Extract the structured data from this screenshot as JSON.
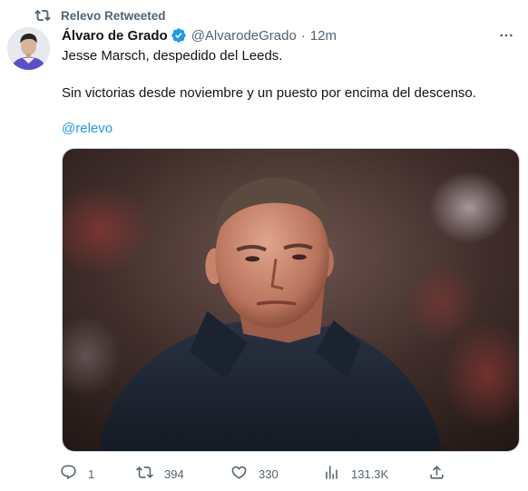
{
  "retweet": {
    "label": "Relevo Retweeted",
    "icon": "retweet-icon"
  },
  "author": {
    "name": "Álvaro de Grado",
    "handle": "@AlvarodeGrado",
    "separator": "·",
    "time": "12m",
    "verified_color": "#1d9bf0"
  },
  "tweet": {
    "line1": "Jesse Marsch, despedido del Leeds.",
    "line2": "Sin victorias desde noviembre y un puesto por encima del descenso.",
    "mention": "@relevo"
  },
  "actions": {
    "reply_count": "1",
    "retweet_count": "394",
    "like_count": "330",
    "views_count": "131.3K"
  },
  "colors": {
    "accent": "#1d9bf0",
    "secondary_text": "#536471",
    "text": "#0f1419"
  }
}
